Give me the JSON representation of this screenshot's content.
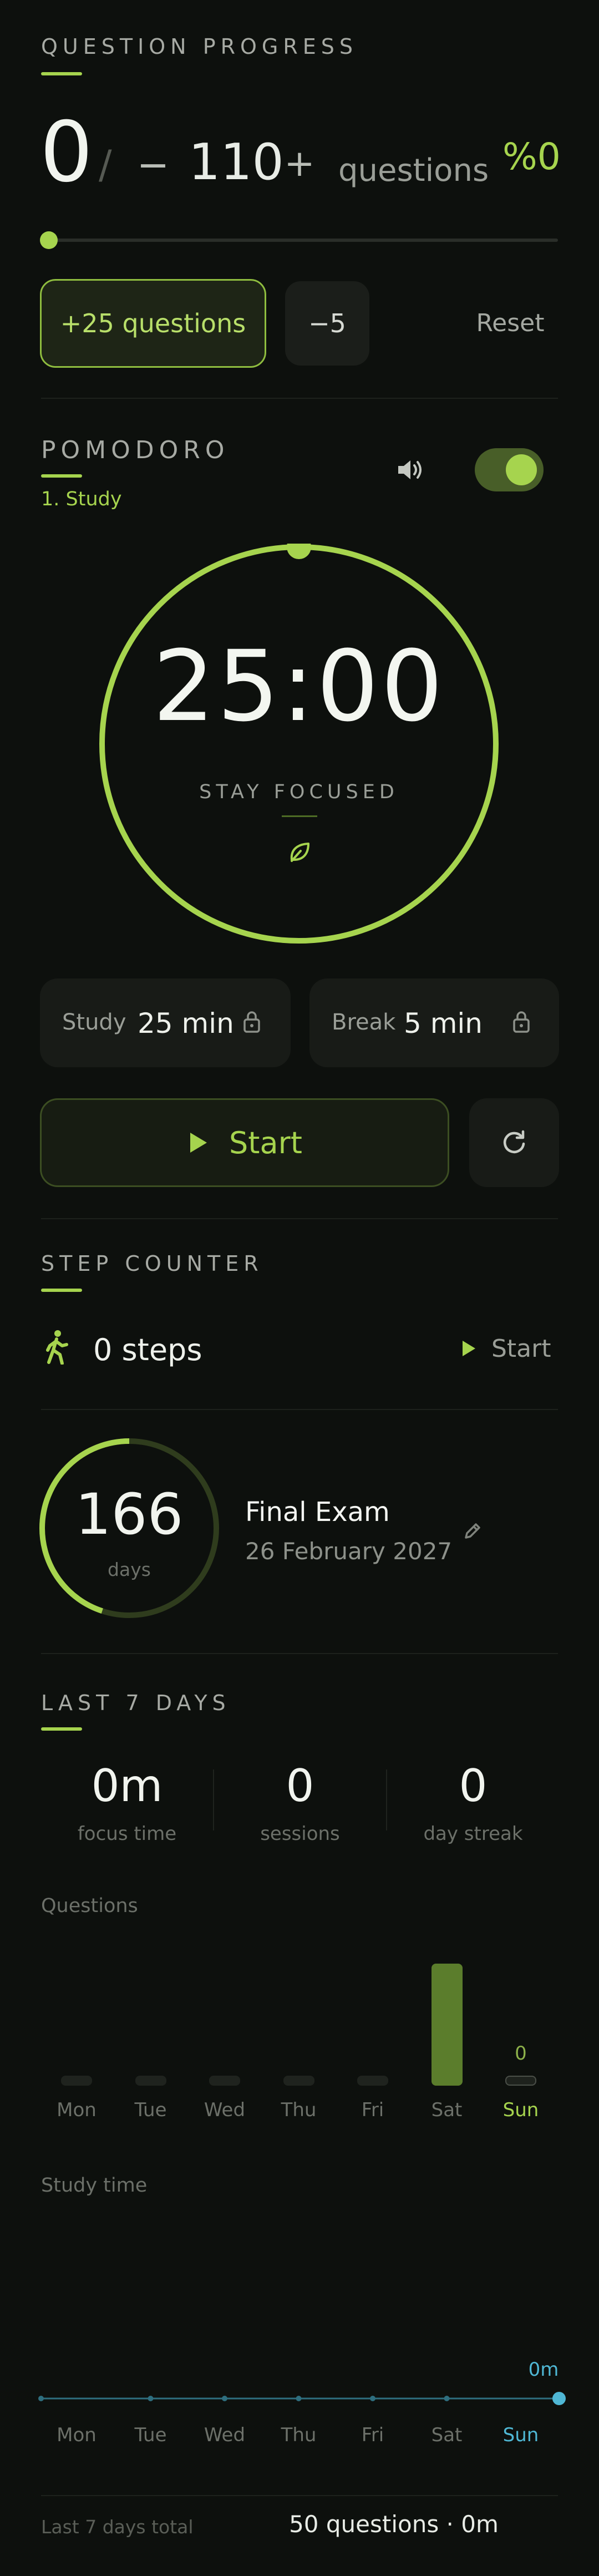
{
  "question_progress": {
    "title": "QUESTION PROGRESS",
    "current": "0",
    "separator": "/",
    "minus": "−",
    "target": "110",
    "plus": "+",
    "unit": "questions",
    "percent": "%0",
    "progress_fraction": 0,
    "add_button": "+25 questions",
    "subtract_button": "−5",
    "reset_button": "Reset"
  },
  "pomodoro": {
    "title": "POMODORO",
    "phase": "1. Study",
    "sound_on": true,
    "toggle_on": true,
    "time": "25:00",
    "status": "STAY FOCUSED",
    "study_label": "Study",
    "study_value": "25 min",
    "break_label": "Break",
    "break_value": "5 min",
    "start_label": "Start"
  },
  "step_counter": {
    "title": "STEP COUNTER",
    "steps": "0 steps",
    "start_label": "Start"
  },
  "exam": {
    "days_count": "166",
    "days_label": "days",
    "name": "Final Exam",
    "date": "26 February 2027",
    "ring_fraction": 0.45
  },
  "last7": {
    "title": "LAST 7 DAYS",
    "stats": [
      {
        "value": "0m",
        "label": "focus time"
      },
      {
        "value": "0",
        "label": "sessions"
      },
      {
        "value": "0",
        "label": "day streak"
      }
    ],
    "questions_title": "Questions",
    "study_time_title": "Study time",
    "days": [
      "Mon",
      "Tue",
      "Wed",
      "Thu",
      "Fri",
      "Sat",
      "Sun"
    ],
    "today_index": 6,
    "questions_values": [
      0,
      0,
      0,
      0,
      0,
      50,
      0
    ],
    "today_question_label": "0",
    "study_time_values": [
      0,
      0,
      0,
      0,
      0,
      0,
      0
    ],
    "today_study_label": "0m",
    "total_label": "Last 7 days total",
    "total_value": "50 questions · 0m"
  },
  "colors": {
    "accent": "#a6d44e",
    "background": "#0d100d",
    "today_blue": "#4fb7d4",
    "bar_past": "#5b7d2c"
  }
}
